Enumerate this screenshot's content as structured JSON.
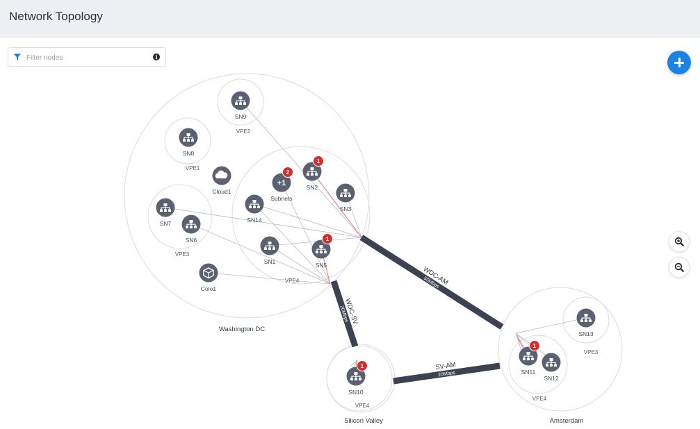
{
  "header": {
    "title": "Network Topology"
  },
  "filter": {
    "placeholder": "Filter nodes",
    "value": ""
  },
  "toolbar": {
    "add_label": "+",
    "zoom_in": "zoom-in",
    "zoom_out": "zoom-out"
  },
  "colors": {
    "node_fill": "#5b6170",
    "badge": "#d32f2f",
    "link_thick": "#3b4252",
    "accent": "#1b82e6",
    "circle_stroke": "#dcdcdc",
    "thin_line": "#b8bcc4",
    "alert_line": "#e57373"
  },
  "sites": [
    {
      "id": "wdc",
      "label": "Washington DC"
    },
    {
      "id": "sv",
      "label": "Silicon Valley"
    },
    {
      "id": "am",
      "label": "Amsterdam"
    }
  ],
  "vpes": [
    "VPE1",
    "VPE2",
    "VPE3",
    "VPE4",
    "VPE4",
    "VPE3",
    "VPE4"
  ],
  "nodes": [
    {
      "id": "SN9",
      "label": "SN9",
      "icon": "network-icon",
      "badge": null
    },
    {
      "id": "SN8",
      "label": "SN8",
      "icon": "network-icon",
      "badge": null
    },
    {
      "id": "Cloud1",
      "label": "Cloud1",
      "icon": "cloud-icon",
      "badge": null
    },
    {
      "id": "Subnets",
      "label": "Subnets",
      "icon": "plus-one-icon",
      "badge": "2"
    },
    {
      "id": "SN2",
      "label": "SN2",
      "icon": "network-icon",
      "badge": "1"
    },
    {
      "id": "SN3",
      "label": "SN3",
      "icon": "network-icon",
      "badge": null
    },
    {
      "id": "SN7",
      "label": "SN7",
      "icon": "network-icon",
      "badge": null
    },
    {
      "id": "SN6",
      "label": "SN6",
      "icon": "network-icon",
      "badge": null
    },
    {
      "id": "SN14",
      "label": "SN14",
      "icon": "network-icon",
      "badge": null
    },
    {
      "id": "SN1",
      "label": "SN1",
      "icon": "network-icon",
      "badge": null
    },
    {
      "id": "SN5",
      "label": "SN5",
      "icon": "network-icon",
      "badge": "1"
    },
    {
      "id": "Colo1",
      "label": "Colo1",
      "icon": "colo-icon",
      "badge": null
    },
    {
      "id": "SN10",
      "label": "SN10",
      "icon": "network-icon",
      "badge": "1"
    },
    {
      "id": "SN13",
      "label": "SN13",
      "icon": "network-icon",
      "badge": null
    },
    {
      "id": "SN11",
      "label": "SN11",
      "icon": "network-icon",
      "badge": "1"
    },
    {
      "id": "SN12",
      "label": "SN12",
      "icon": "network-icon",
      "badge": null
    }
  ],
  "links": [
    {
      "id": "wdc-am",
      "name": "WDC-AM",
      "bandwidth": "50Mbps"
    },
    {
      "id": "wdc-sv",
      "name": "WDC-SV",
      "bandwidth": "20Mbps"
    },
    {
      "id": "sv-am",
      "name": "SV-AM",
      "bandwidth": "20Mbps"
    }
  ]
}
